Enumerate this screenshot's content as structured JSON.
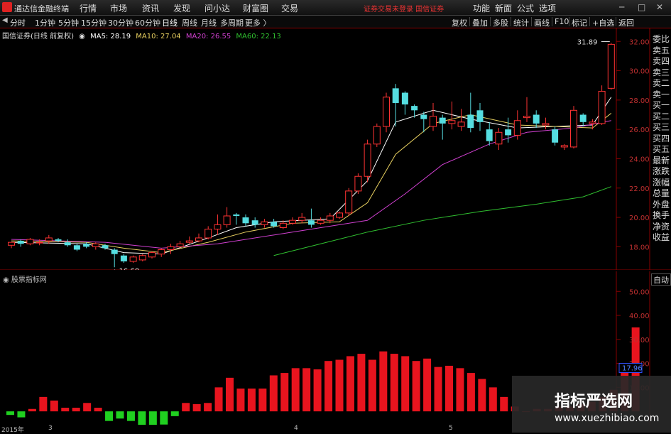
{
  "app": {
    "title": "通达信金融终端",
    "menus": [
      "行情",
      "市场",
      "资讯",
      "发现",
      "问小达",
      "财富圈",
      "交易"
    ],
    "notice": "证券交易未登录  国信证券",
    "right_menus": [
      "功能",
      "新面",
      "公式",
      "选项"
    ],
    "window_buttons": [
      "─",
      "□",
      "✕"
    ]
  },
  "periods": [
    "分时",
    "1分钟",
    "5分钟",
    "15分钟",
    "30分钟",
    "60分钟",
    "日线",
    "周线",
    "月线",
    "多周期",
    "更多 〉"
  ],
  "active_period": "日线",
  "tools": [
    "复权",
    "叠加",
    "多股",
    "统计",
    "画线",
    "F10",
    "标记",
    "+自选",
    "返回"
  ],
  "legend": {
    "stock": "国信证券(日线 前复权)",
    "ma5": "MA5: 28.19",
    "ma10": "MA10: 27.04",
    "ma20": "MA20: 26.55",
    "ma60": "MA60: 22.13"
  },
  "colors": {
    "ma5": "#ffffff",
    "ma10": "#e8d060",
    "ma20": "#d040d0",
    "ma60": "#30c030",
    "up": "#ff3333",
    "down": "#55dde0"
  },
  "price_axis": {
    "labels": [
      "32.00",
      "30.00",
      "28.00",
      "26.00",
      "24.00",
      "22.00",
      "20.00",
      "18.00"
    ],
    "high_label": "31.89",
    "low_label": "←16.60"
  },
  "side_tabs": [
    "委比",
    "卖五",
    "卖四",
    "卖三",
    "卖二",
    "卖一",
    "买一",
    "买二",
    "买三",
    "买四",
    "买五",
    "最新",
    "涨跌",
    "涨幅",
    "总量",
    "外盘",
    "换手",
    "净资",
    "收益"
  ],
  "indicator": {
    "title": "股票指标网",
    "auto_label": "自动",
    "axis_labels": [
      "50.00",
      "40.00",
      "30.00",
      "20.00",
      "10.00"
    ],
    "current_value": "17.96"
  },
  "dates": [
    "2015年",
    "3",
    "4",
    "5"
  ],
  "watermark": {
    "cn": "指标严选网",
    "url": "www.xuezhibiao.com"
  },
  "chart_data": [
    {
      "type": "candlestick",
      "title": "国信证券(日线 前复权)",
      "ylim": [
        17.0,
        32.4
      ],
      "candles": [
        [
          18.1,
          18.3,
          17.9,
          18.2
        ],
        [
          18.4,
          18.2,
          18.0,
          18.5
        ],
        [
          18.2,
          18.5,
          18.1,
          18.6
        ],
        [
          18.3,
          18.3,
          18.1,
          18.5
        ],
        [
          18.4,
          18.6,
          18.2,
          18.8
        ],
        [
          18.5,
          18.4,
          18.3,
          18.6
        ],
        [
          18.3,
          18.1,
          18.0,
          18.5
        ],
        [
          18.1,
          17.8,
          17.7,
          18.2
        ],
        [
          18.2,
          18.0,
          17.9,
          18.3
        ],
        [
          18.0,
          18.2,
          17.8,
          18.3
        ],
        [
          18.1,
          17.9,
          17.8,
          18.2
        ],
        [
          17.8,
          17.5,
          16.6,
          17.9
        ],
        [
          17.4,
          17.0,
          16.9,
          17.5
        ],
        [
          17.0,
          17.3,
          16.9,
          17.4
        ],
        [
          17.1,
          17.4,
          17.0,
          17.5
        ],
        [
          17.3,
          17.6,
          17.2,
          17.7
        ],
        [
          17.5,
          17.8,
          17.3,
          17.9
        ],
        [
          17.8,
          18.0,
          17.5,
          18.2
        ],
        [
          18.0,
          18.2,
          17.9,
          18.4
        ],
        [
          18.3,
          18.4,
          18.2,
          18.7
        ],
        [
          18.4,
          18.6,
          18.3,
          18.9
        ],
        [
          18.6,
          19.2,
          18.5,
          19.4
        ],
        [
          19.2,
          19.5,
          18.8,
          20.2
        ],
        [
          19.5,
          20.1,
          19.3,
          20.7
        ],
        [
          20.2,
          20.1,
          19.5,
          20.3
        ],
        [
          20.0,
          19.6,
          19.4,
          20.2
        ],
        [
          19.8,
          19.5,
          19.3,
          20.0
        ],
        [
          19.5,
          19.7,
          19.3,
          19.9
        ],
        [
          19.7,
          19.4,
          19.3,
          19.9
        ],
        [
          19.3,
          19.6,
          19.2,
          19.8
        ],
        [
          19.6,
          19.8,
          19.5,
          20.0
        ],
        [
          19.8,
          20.0,
          19.6,
          20.3
        ],
        [
          19.8,
          19.5,
          19.3,
          20.6
        ],
        [
          19.6,
          19.8,
          19.5,
          20.0
        ],
        [
          19.8,
          20.1,
          19.6,
          20.3
        ],
        [
          20.0,
          20.3,
          19.9,
          20.4
        ],
        [
          20.3,
          21.8,
          20.1,
          22.0
        ],
        [
          21.8,
          22.8,
          21.6,
          23.0
        ],
        [
          22.8,
          25.0,
          22.4,
          25.3
        ],
        [
          25.0,
          26.2,
          24.8,
          26.4
        ],
        [
          26.2,
          28.2,
          25.8,
          28.5
        ],
        [
          28.8,
          27.8,
          26.2,
          29.1
        ],
        [
          28.5,
          27.7,
          27.0,
          28.6
        ],
        [
          27.6,
          27.3,
          26.8,
          27.7
        ],
        [
          27.0,
          26.7,
          25.8,
          27.2
        ],
        [
          26.2,
          26.9,
          25.9,
          27.8
        ],
        [
          26.8,
          26.4,
          25.3,
          27.0
        ],
        [
          26.4,
          26.6,
          26.0,
          27.9
        ],
        [
          26.2,
          26.5,
          25.9,
          27.4
        ],
        [
          27.0,
          26.1,
          25.8,
          28.5
        ],
        [
          27.3,
          26.5,
          25.9,
          27.8
        ],
        [
          26.0,
          25.2,
          24.9,
          26.5
        ],
        [
          25.0,
          25.8,
          24.6,
          26.1
        ],
        [
          26.0,
          25.6,
          25.1,
          26.8
        ],
        [
          25.6,
          26.6,
          25.3,
          27.3
        ],
        [
          26.8,
          26.9,
          26.5,
          28.2
        ],
        [
          27.0,
          26.4,
          26.1,
          27.3
        ],
        [
          26.3,
          26.4,
          26.0,
          26.8
        ],
        [
          26.0,
          25.1,
          24.9,
          26.2
        ],
        [
          24.8,
          24.9,
          24.6,
          25.0
        ],
        [
          24.8,
          27.3,
          24.7,
          27.6
        ],
        [
          27.0,
          26.5,
          26.2,
          27.1
        ],
        [
          26.4,
          26.5,
          26.0,
          26.7
        ],
        [
          26.4,
          28.6,
          26.3,
          29.0
        ],
        [
          28.8,
          31.8,
          28.7,
          31.89
        ]
      ],
      "ma_series": [
        {
          "name": "MA5",
          "points": [
            [
              0,
              18.3
            ],
            [
              8,
              18.2
            ],
            [
              12,
              17.6
            ],
            [
              16,
              17.5
            ],
            [
              21,
              18.6
            ],
            [
              24,
              19.3
            ],
            [
              28,
              19.7
            ],
            [
              34,
              19.9
            ],
            [
              38,
              22.5
            ],
            [
              41,
              26.5
            ],
            [
              45,
              27.3
            ],
            [
              49,
              26.7
            ],
            [
              54,
              26.1
            ],
            [
              58,
              26.2
            ],
            [
              62,
              26.3
            ],
            [
              64,
              28.2
            ]
          ]
        },
        {
          "name": "MA10",
          "points": [
            [
              0,
              18.4
            ],
            [
              8,
              18.3
            ],
            [
              12,
              17.9
            ],
            [
              16,
              17.6
            ],
            [
              21,
              18.3
            ],
            [
              25,
              19.0
            ],
            [
              30,
              19.6
            ],
            [
              35,
              19.7
            ],
            [
              38,
              21.0
            ],
            [
              41,
              24.3
            ],
            [
              45,
              26.4
            ],
            [
              49,
              27.0
            ],
            [
              54,
              26.3
            ],
            [
              58,
              26.2
            ],
            [
              62,
              26.1
            ],
            [
              64,
              27.1
            ]
          ]
        },
        {
          "name": "MA20",
          "points": [
            [
              0,
              18.5
            ],
            [
              10,
              18.3
            ],
            [
              16,
              17.9
            ],
            [
              22,
              18.2
            ],
            [
              28,
              18.8
            ],
            [
              35,
              19.5
            ],
            [
              38,
              19.8
            ],
            [
              42,
              21.6
            ],
            [
              46,
              23.6
            ],
            [
              51,
              25.0
            ],
            [
              55,
              25.8
            ],
            [
              60,
              26.1
            ],
            [
              64,
              26.6
            ]
          ]
        },
        {
          "name": "MA60",
          "points": [
            [
              28,
              17.4
            ],
            [
              33,
              18.2
            ],
            [
              38,
              19.0
            ],
            [
              44,
              19.8
            ],
            [
              50,
              20.4
            ],
            [
              56,
              20.9
            ],
            [
              61,
              21.4
            ],
            [
              64,
              22.1
            ]
          ]
        }
      ]
    },
    {
      "type": "bar",
      "title": "股票指标网",
      "ylim": [
        -5,
        56
      ],
      "values": [
        -1.5,
        -2.5,
        1,
        6,
        4.5,
        1.5,
        1.5,
        3.5,
        1.5,
        -4,
        -3,
        -4,
        -9,
        -9.5,
        -5.5,
        -2,
        3.5,
        3,
        3.5,
        10,
        14,
        9.5,
        9.5,
        9.5,
        15,
        16,
        18,
        18,
        17.5,
        21,
        21.5,
        23,
        24,
        21.5,
        25,
        24,
        23,
        21,
        22,
        18.5,
        19,
        18,
        16,
        13.5,
        10,
        6,
        2,
        0,
        1,
        1,
        2,
        2,
        3,
        4,
        6,
        9,
        17.96,
        35
      ]
    }
  ]
}
